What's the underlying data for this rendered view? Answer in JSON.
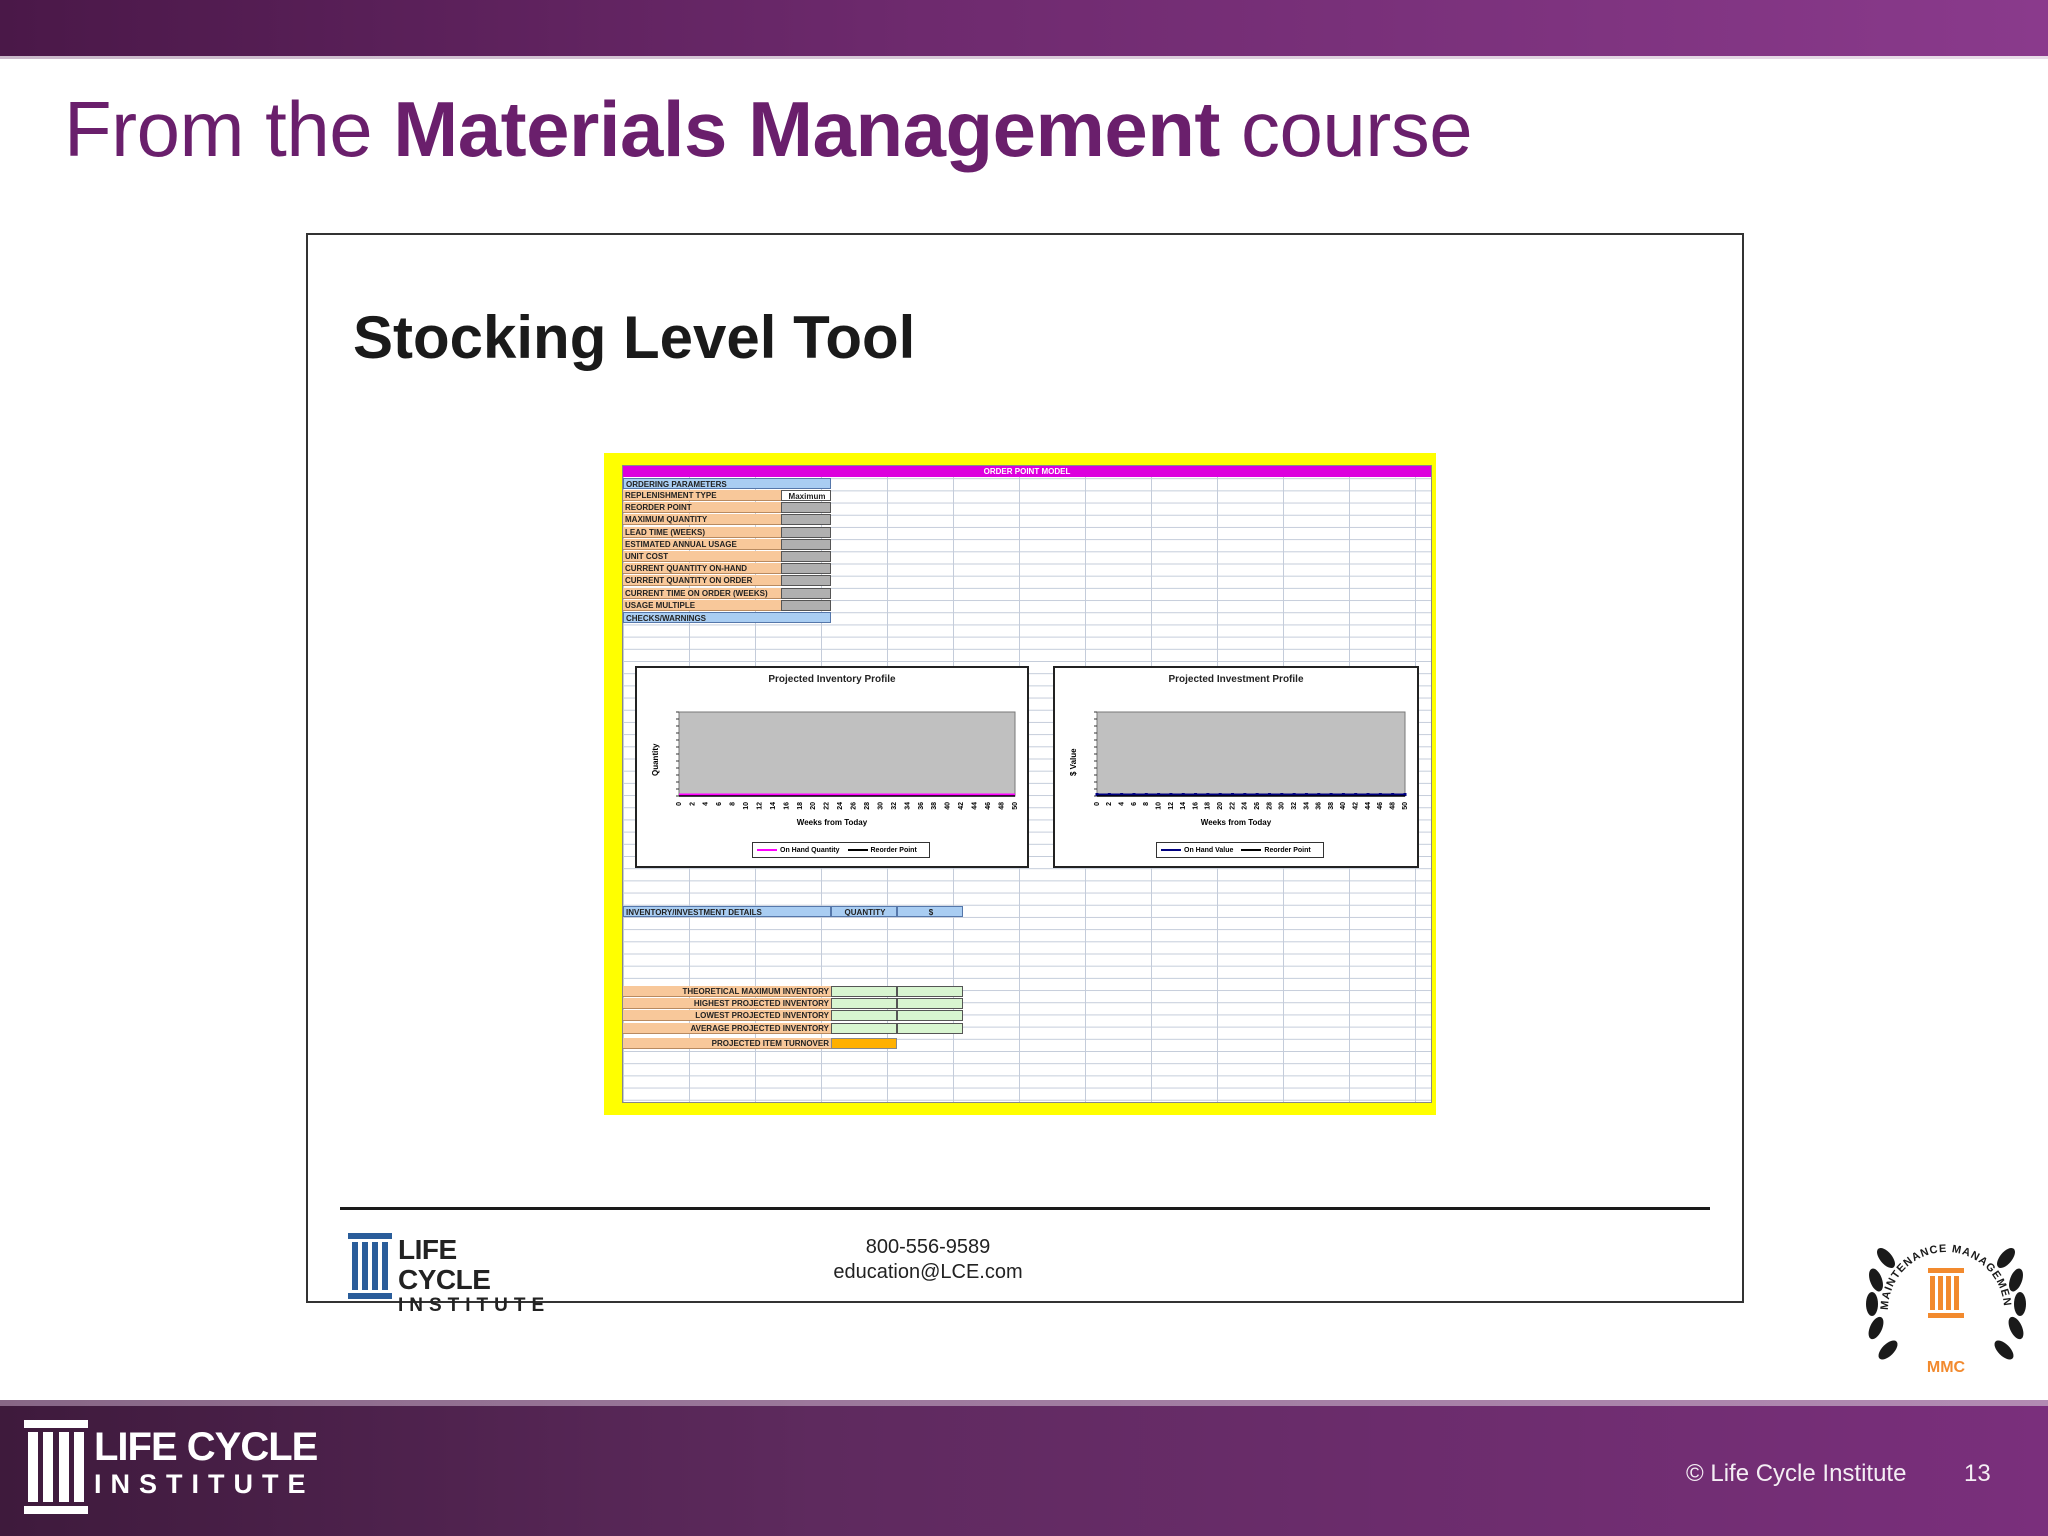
{
  "slide": {
    "title_prefix": "From the ",
    "title_bold": "Materials Management",
    "title_suffix": " course",
    "copyright": "© Life Cycle Institute",
    "page_number": "13",
    "colors": {
      "brand_purple": "#6a1f6c",
      "band_purple": "#6e2a6e",
      "accent_orange": "#f28a2e"
    }
  },
  "frame": {
    "title": "Stocking Level Tool",
    "contact_phone": "800-556-9589",
    "contact_email": "education@LCE.com",
    "logo_line1": "LIFE CYCLE",
    "logo_line2": "INSTITUTE"
  },
  "seal": {
    "ring_text": "MAINTENANCE MANAGEMENT CERTIFICATION",
    "badge": "MMC"
  },
  "spreadsheet": {
    "header": "ORDER POINT MODEL",
    "ordering_section": "ORDERING PARAMETERS",
    "parameters": [
      {
        "label": "REPLENISHMENT TYPE",
        "value": "Maximum"
      },
      {
        "label": "REORDER POINT",
        "value": ""
      },
      {
        "label": "MAXIMUM QUANTITY",
        "value": ""
      },
      {
        "label": "LEAD TIME (WEEKS)",
        "value": ""
      },
      {
        "label": "ESTIMATED ANNUAL USAGE",
        "value": ""
      },
      {
        "label": "UNIT COST",
        "value": ""
      },
      {
        "label": "CURRENT QUANTITY ON-HAND",
        "value": ""
      },
      {
        "label": "CURRENT QUANTITY ON ORDER",
        "value": ""
      },
      {
        "label": "CURRENT TIME ON ORDER (WEEKS)",
        "value": ""
      },
      {
        "label": "USAGE MULTIPLE",
        "value": ""
      }
    ],
    "checks_label": "CHECKS/WARNINGS",
    "details_label": "INVENTORY/INVESTMENT DETAILS",
    "details_col_quantity": "QUANTITY",
    "details_col_dollar": "$",
    "summary_rows": [
      "THEORETICAL MAXIMUM INVENTORY",
      "HIGHEST PROJECTED INVENTORY",
      "LOWEST PROJECTED INVENTORY",
      "AVERAGE PROJECTED INVENTORY"
    ],
    "turnover_label": "PROJECTED ITEM TURNOVER"
  },
  "chart_data": [
    {
      "type": "line",
      "title": "Projected Inventory Profile",
      "xlabel": "Weeks from Today",
      "ylabel": "Quantity",
      "x": [
        0,
        2,
        4,
        6,
        8,
        10,
        12,
        14,
        16,
        18,
        20,
        22,
        24,
        26,
        28,
        30,
        32,
        34,
        36,
        38,
        40,
        42,
        44,
        46,
        48,
        50
      ],
      "series": [
        {
          "name": "On Hand Quantity",
          "color": "#ff00ff",
          "values": [
            0,
            0,
            0,
            0,
            0,
            0,
            0,
            0,
            0,
            0,
            0,
            0,
            0,
            0,
            0,
            0,
            0,
            0,
            0,
            0,
            0,
            0,
            0,
            0,
            0,
            0
          ]
        },
        {
          "name": "Reorder Point",
          "color": "#000000",
          "values": [
            0,
            0,
            0,
            0,
            0,
            0,
            0,
            0,
            0,
            0,
            0,
            0,
            0,
            0,
            0,
            0,
            0,
            0,
            0,
            0,
            0,
            0,
            0,
            0,
            0,
            0
          ]
        }
      ],
      "plot_background": "#c0c0c0",
      "legend": "bottom"
    },
    {
      "type": "line",
      "title": "Projected Investment Profile",
      "xlabel": "Weeks from Today",
      "ylabel": "$ Value",
      "x": [
        0,
        2,
        4,
        6,
        8,
        10,
        12,
        14,
        16,
        18,
        20,
        22,
        24,
        26,
        28,
        30,
        32,
        34,
        36,
        38,
        40,
        42,
        44,
        46,
        48,
        50
      ],
      "series": [
        {
          "name": "On Hand Value",
          "color": "#000080",
          "values": [
            0,
            0,
            0,
            0,
            0,
            0,
            0,
            0,
            0,
            0,
            0,
            0,
            0,
            0,
            0,
            0,
            0,
            0,
            0,
            0,
            0,
            0,
            0,
            0,
            0,
            0
          ]
        },
        {
          "name": "Reorder Point",
          "color": "#000000",
          "values": [
            0,
            0,
            0,
            0,
            0,
            0,
            0,
            0,
            0,
            0,
            0,
            0,
            0,
            0,
            0,
            0,
            0,
            0,
            0,
            0,
            0,
            0,
            0,
            0,
            0,
            0
          ]
        }
      ],
      "plot_background": "#c0c0c0",
      "legend": "bottom"
    }
  ]
}
